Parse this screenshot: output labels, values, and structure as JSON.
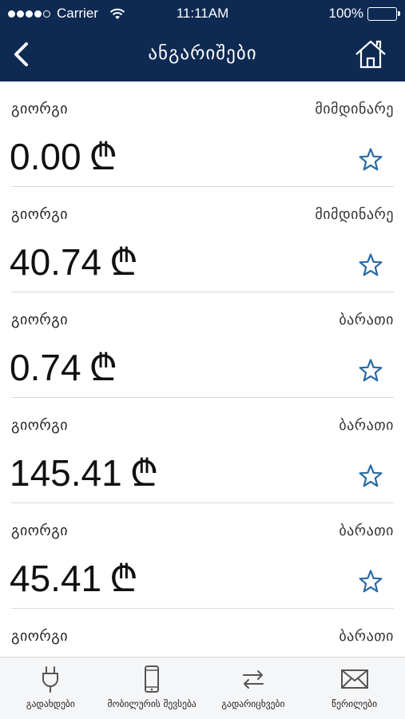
{
  "status_bar": {
    "carrier": "Carrier",
    "time": "11:11AM",
    "battery": "100%"
  },
  "nav": {
    "title": "ანგარიშები",
    "back_icon": "chevron-left-icon",
    "home_icon": "home-icon"
  },
  "accounts": [
    {
      "owner": "გიორგი",
      "type": "მიმდინარე",
      "amount": "0.00",
      "currency": "₾"
    },
    {
      "owner": "გიორგი",
      "type": "მიმდინარე",
      "amount": "40.74",
      "currency": "₾"
    },
    {
      "owner": "გიორგი",
      "type": "ბარათი",
      "amount": "0.74",
      "currency": "₾"
    },
    {
      "owner": "გიორგი",
      "type": "ბარათი",
      "amount": "145.41",
      "currency": "₾"
    },
    {
      "owner": "გიორგი",
      "type": "ბარათი",
      "amount": "45.41",
      "currency": "₾"
    },
    {
      "owner": "გიორგი",
      "type": "ბარათი",
      "amount": "",
      "currency": ""
    }
  ],
  "tabs": [
    {
      "label": "გადახდები",
      "icon": "plug-icon"
    },
    {
      "label": "მობილურის შევსება",
      "icon": "mobile-phone-icon"
    },
    {
      "label": "გადარიცხვები",
      "icon": "transfer-arrows-icon"
    },
    {
      "label": "წერილები",
      "icon": "envelope-icon"
    }
  ],
  "colors": {
    "header_bg": "#0e2a52",
    "star": "#2a6aa3",
    "tab_bg": "#f5f6f8"
  }
}
